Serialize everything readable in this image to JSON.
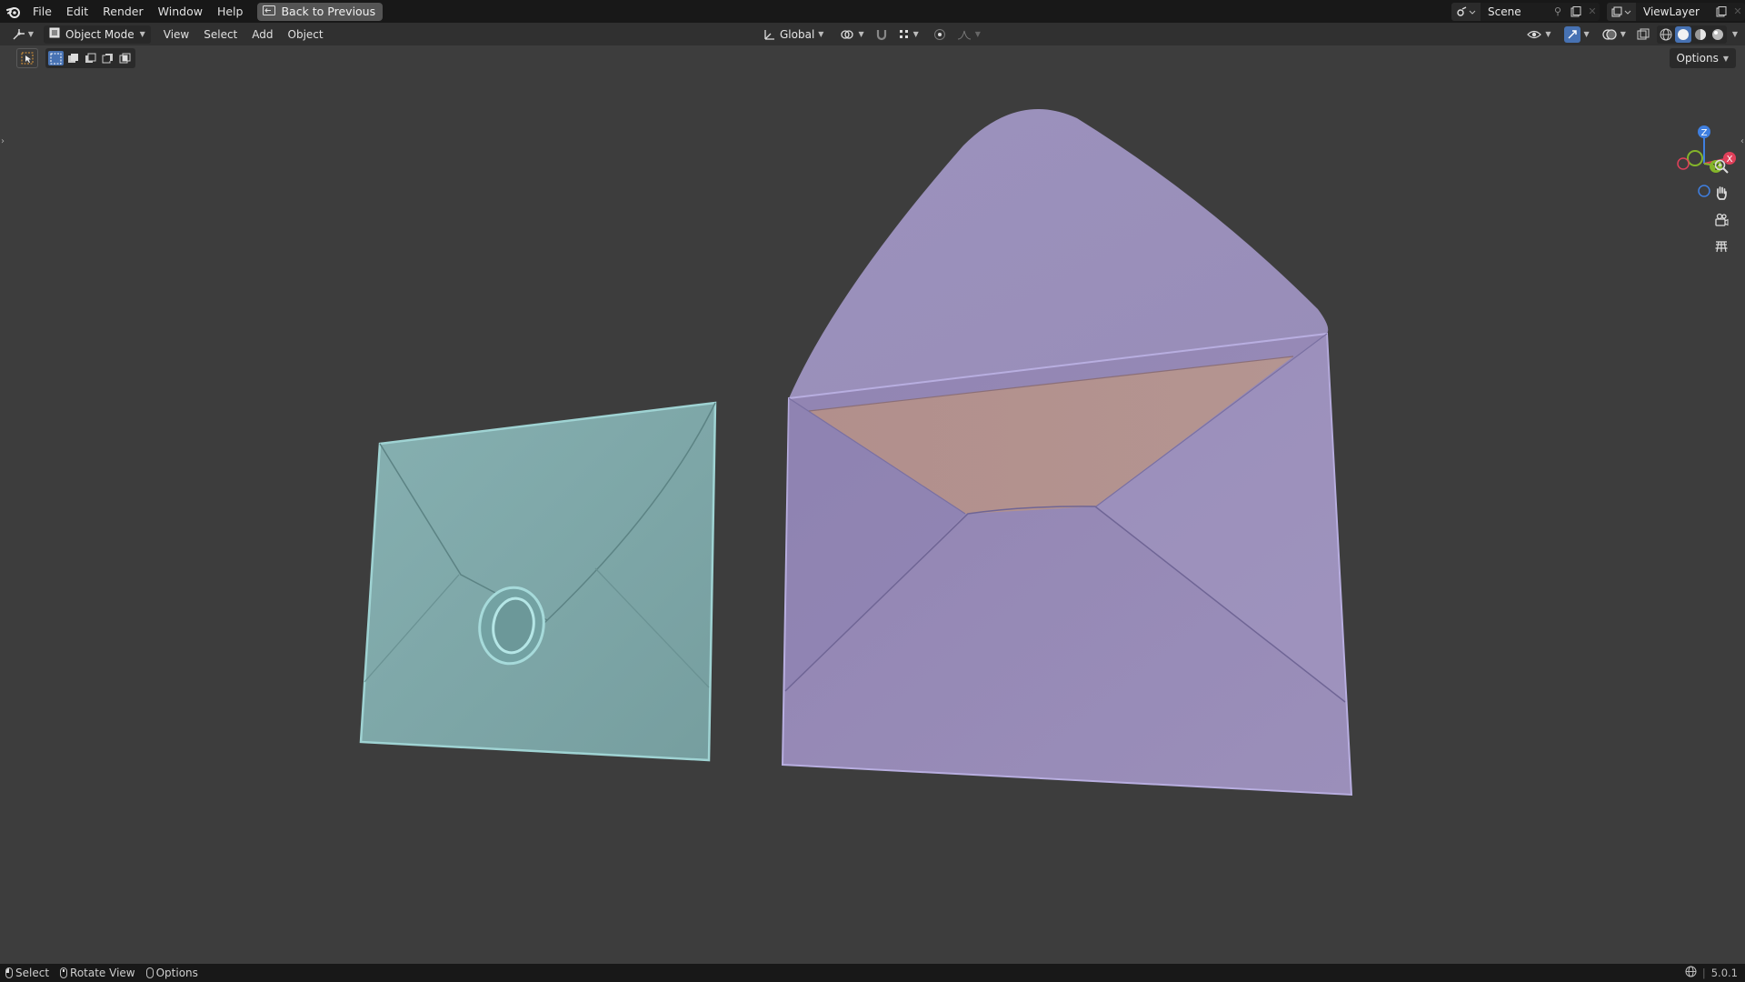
{
  "topbar": {
    "menu": [
      "File",
      "Edit",
      "Render",
      "Window",
      "Help"
    ],
    "back_button": "Back to Previous",
    "scene_name": "Scene",
    "view_layer": "ViewLayer"
  },
  "header": {
    "mode": "Object Mode",
    "menus": [
      "View",
      "Select",
      "Add",
      "Object"
    ],
    "transform_orientation": "Global",
    "options_label": "Options"
  },
  "viewport": {
    "objects": [
      {
        "name": "closed-envelope",
        "color": "#7fa9aa",
        "has_wax_seal": true
      },
      {
        "name": "open-envelope",
        "color": "#9589b4",
        "inner_color": "#b38f8e"
      }
    ],
    "gizmo_axes": [
      "Z",
      "Y",
      "X"
    ],
    "nav_icons": [
      "zoom-icon",
      "hand-pan-icon",
      "camera-icon",
      "grid-icon"
    ]
  },
  "statusbar": {
    "items": [
      "Select",
      "Rotate View",
      "Options"
    ],
    "version": "5.0.1"
  },
  "colors": {
    "topbar_bg": "#181818",
    "header_bg": "#303030",
    "viewport_bg": "#3d3d3d",
    "accent": "#4772b3",
    "axis_x": "#e0405a",
    "axis_y": "#84b52a",
    "axis_z": "#3f7fe0"
  }
}
